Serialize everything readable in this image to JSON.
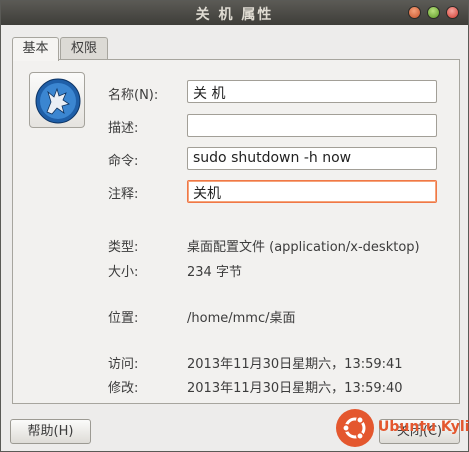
{
  "window": {
    "title": "关 机 属性"
  },
  "tabs": [
    {
      "label": "基本"
    },
    {
      "label": "权限"
    }
  ],
  "icon": {
    "name": "wolf-app-icon"
  },
  "form": {
    "name_label": "名称(N):",
    "name_value": "关 机",
    "desc_label": "描述:",
    "desc_value": "",
    "cmd_label": "命令:",
    "cmd_value": "sudo shutdown -h now",
    "comment_label": "注释:",
    "comment_value": "关机"
  },
  "info": {
    "type_label": "类型:",
    "type_value": "桌面配置文件 (application/x-desktop)",
    "size_label": "大小:",
    "size_value": "234 字节",
    "location_label": "位置:",
    "location_value": "/home/mmc/桌面",
    "accessed_label": "访问:",
    "accessed_value": "2013年11月30日星期六，13:59:41",
    "modified_label": "修改:",
    "modified_value": "2013年11月30日星期六，13:59:40"
  },
  "buttons": {
    "help": "帮助(H)",
    "close": "关闭(C)"
  },
  "watermark": {
    "text": "Ubuntu Kylin"
  },
  "colors": {
    "titlebar": "#3f3e3a",
    "accent": "#f07746",
    "watermark": "#e4572e"
  }
}
